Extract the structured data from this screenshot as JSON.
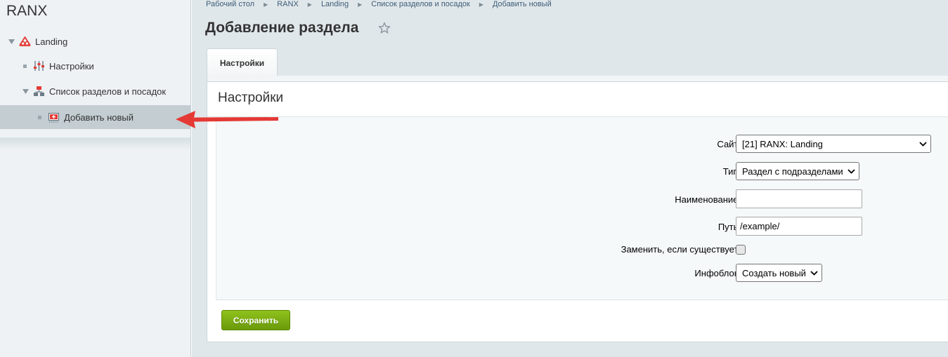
{
  "brand": "RANX",
  "sidebar": {
    "items": [
      {
        "label": "Landing",
        "icon": "landing-logo-icon"
      },
      {
        "label": "Настройки",
        "icon": "sliders-icon"
      },
      {
        "label": "Список разделов и посадок",
        "icon": "sections-list-icon"
      },
      {
        "label": "Добавить новый",
        "icon": "add-new-icon"
      }
    ]
  },
  "breadcrumb": [
    "Рабочий стол",
    "RANX",
    "Landing",
    "Список разделов и посадок",
    "Добавить новый"
  ],
  "page": {
    "title": "Добавление раздела"
  },
  "tabs": [
    {
      "label": "Настройки"
    }
  ],
  "panel": {
    "title": "Настройки"
  },
  "form": {
    "site": {
      "label": "Сайт:",
      "value": "[21] RANX: Landing"
    },
    "type": {
      "label": "Тип:",
      "value": "Раздел с подразделами"
    },
    "name": {
      "label": "Наименование:",
      "value": ""
    },
    "path": {
      "label": "Путь:",
      "value": "/example/"
    },
    "replace": {
      "label": "Заменить, если существует:",
      "checked": false
    },
    "iblock": {
      "label": "Инфоблок:",
      "value": "Создать новый"
    }
  },
  "actions": {
    "save_label": "Сохранить"
  },
  "colors": {
    "accent_green": "#7aae12",
    "active_item": "#c3cdd2",
    "arrow_red": "#e53935"
  }
}
